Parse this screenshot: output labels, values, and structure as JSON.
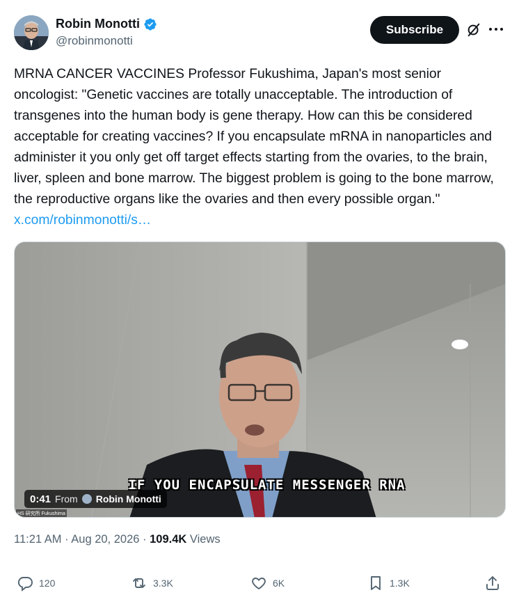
{
  "author": {
    "display_name": "Robin Monotti",
    "handle": "@robinmonotti",
    "verified_icon": "verified-badge-icon"
  },
  "header": {
    "subscribe_label": "Subscribe",
    "grok_icon": "grok-icon",
    "more_icon": "more-icon"
  },
  "tweet": {
    "text": "MRNA CANCER VACCINES Professor Fukushima, Japan's most senior oncologist: \"Genetic vaccines are totally unacceptable. The introduction of transgenes into the human body is gene therapy. How can this be considered acceptable for creating vaccines? If you encapsulate mRNA in nanoparticles and administer it you only get off target effects starting from the ovaries, to the brain, liver, spleen and bone marrow. The biggest problem is going to the bone marrow, the reproductive organs like the ovaries and then every possible organ.\" ",
    "link_text": "x.com/robinmonotti/s…"
  },
  "video": {
    "caption": "IF YOU ENCAPSULATE MESSENGER RNA",
    "duration": "0:41",
    "from_label": "From",
    "from_source": "Robin Monotti",
    "watermark": "HS 研究所 Fukushima"
  },
  "meta": {
    "time": "11:21 AM",
    "separator": " · ",
    "date": "Aug 20, 2026",
    "views_count": "109.4K",
    "views_label": " Views"
  },
  "actions": {
    "replies": "120",
    "reposts": "3.3K",
    "likes": "6K",
    "bookmarks": "1.3K"
  },
  "colors": {
    "accent": "#1d9bf0",
    "text": "#0f1419",
    "muted": "#536471",
    "button_bg": "#0f1419"
  }
}
